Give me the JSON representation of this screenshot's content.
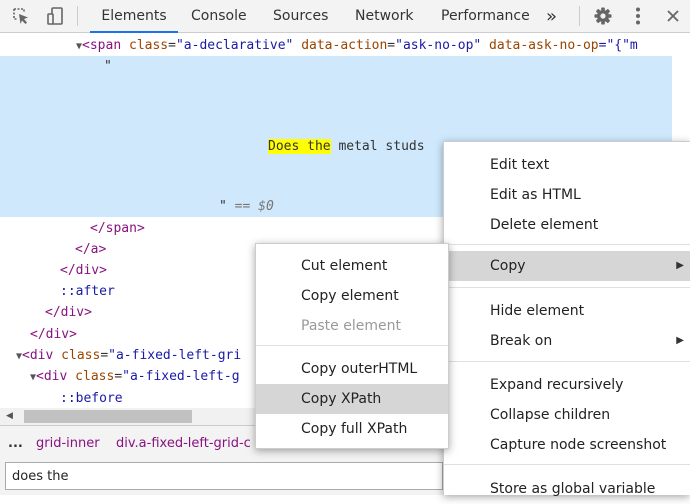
{
  "toolbar": {
    "tabs": [
      {
        "label": "Elements",
        "active": true
      },
      {
        "label": "Console"
      },
      {
        "label": "Sources"
      },
      {
        "label": "Network"
      },
      {
        "label": "Performance"
      }
    ],
    "more_tabs": "»"
  },
  "tree": {
    "span_open": {
      "tag": "<span",
      "attr1": "class",
      "val1": "\"a-declarative\"",
      "attr2": "data-action",
      "val2": "\"ask-no-op\"",
      "attr3": "data-ask-no-op",
      "val3": "=\"{\"m"
    },
    "quote_open": "\"",
    "text_highlight": "Does the",
    "text_rest": " metal studs",
    "quote_close": "\"",
    "eq_marker": "== $0",
    "close_span": "</span>",
    "close_a": "</a>",
    "close_div1": "</div>",
    "after": "::after",
    "close_div2": "</div>",
    "close_div3": "</div>",
    "div1": {
      "tag": "<div",
      "attr": "class",
      "val": "\"a-fixed-left-gri"
    },
    "div2": {
      "tag": "<div",
      "attr": "class",
      "val": "\"a-fixed-left-g"
    },
    "before": "::before"
  },
  "breadcrumbs": {
    "ellipsis": "...",
    "item1": "grid-inner",
    "item2": "div.a-fixed-left-grid-c"
  },
  "search": {
    "value": "does the"
  },
  "main_menu": {
    "items": [
      "Edit text",
      "Edit as HTML",
      "Delete element",
      "Copy",
      "Hide element",
      "Break on",
      "Expand recursively",
      "Collapse children",
      "Capture node screenshot",
      "Store as global variable"
    ]
  },
  "copy_menu": {
    "items": [
      "Cut element",
      "Copy element",
      "Paste element",
      "Copy outerHTML",
      "Copy XPath",
      "Copy full XPath"
    ]
  },
  "colors": {
    "selection": "#cfe8fc",
    "highlight": "#ffff00",
    "tag": "#881280",
    "attr": "#994500",
    "value": "#1a1aa6",
    "accent": "#1a73e8"
  }
}
